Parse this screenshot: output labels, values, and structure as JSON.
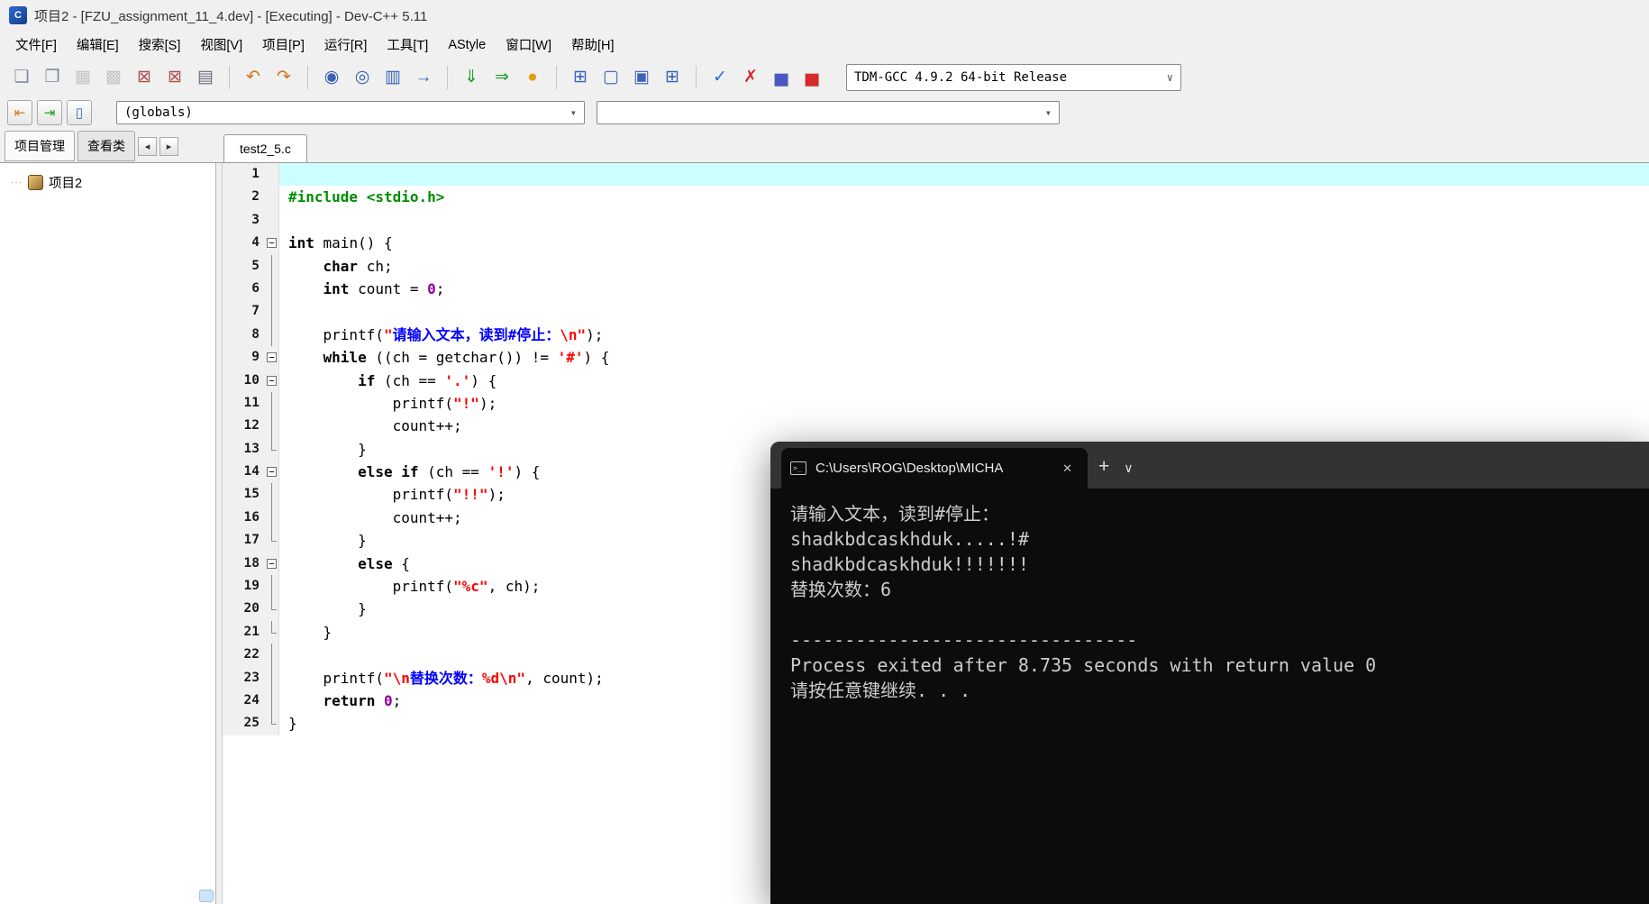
{
  "window": {
    "title": "项目2 - [FZU_assignment_11_4.dev] - [Executing] - Dev-C++ 5.11",
    "app_icon_text": "C"
  },
  "menu": {
    "items": [
      "文件[F]",
      "编辑[E]",
      "搜索[S]",
      "视图[V]",
      "项目[P]",
      "运行[R]",
      "工具[T]",
      "AStyle",
      "窗口[W]",
      "帮助[H]"
    ]
  },
  "toolbar_main": {
    "groups": [
      {
        "buttons": [
          {
            "name": "new-file-button",
            "icon": "new-file-icon",
            "glyph": "❏",
            "color": "#7a8aa0"
          },
          {
            "name": "open-file-button",
            "icon": "open-folder-icon",
            "glyph": "❐",
            "color": "#7a8aa0"
          },
          {
            "name": "save-button",
            "icon": "save-icon",
            "glyph": "▦",
            "color": "#8a8a8a",
            "disabled": true
          },
          {
            "name": "save-all-button",
            "icon": "save-all-icon",
            "glyph": "▩",
            "color": "#8a8a8a",
            "disabled": true
          },
          {
            "name": "close-file-button",
            "icon": "close-file-icon",
            "glyph": "⊠",
            "color": "#b05050"
          },
          {
            "name": "close-all-button",
            "icon": "close-all-icon",
            "glyph": "⊠",
            "color": "#b05050"
          },
          {
            "name": "print-button",
            "icon": "printer-icon",
            "glyph": "▤",
            "color": "#6a6a7a"
          }
        ]
      },
      {
        "buttons": [
          {
            "name": "undo-button",
            "icon": "undo-icon",
            "glyph": "↶",
            "color": "#d07820"
          },
          {
            "name": "redo-button",
            "icon": "redo-icon",
            "glyph": "↷",
            "color": "#d07820"
          }
        ]
      },
      {
        "buttons": [
          {
            "name": "find-button",
            "icon": "find-icon",
            "glyph": "◉",
            "color": "#3a62b8"
          },
          {
            "name": "find-in-files-button",
            "icon": "find-in-files-icon",
            "glyph": "◎",
            "color": "#3a62b8"
          },
          {
            "name": "replace-button",
            "icon": "replace-icon",
            "glyph": "▥",
            "color": "#3a62b8"
          },
          {
            "name": "goto-line-button",
            "icon": "goto-line-icon",
            "glyph": "→",
            "color": "#3a62b8"
          }
        ]
      },
      {
        "buttons": [
          {
            "name": "compile-button",
            "icon": "compile-icon",
            "glyph": "⇓",
            "color": "#1f9d28"
          },
          {
            "name": "run-button",
            "icon": "run-icon",
            "glyph": "⇒",
            "color": "#1f9d28"
          },
          {
            "name": "compile-run-button",
            "icon": "compile-run-icon",
            "glyph": "●",
            "color": "#e0a010"
          }
        ]
      },
      {
        "buttons": [
          {
            "name": "cascade-windows-button",
            "icon": "cascade-windows-icon",
            "glyph": "⊞",
            "color": "#3a62b8"
          },
          {
            "name": "tile-horizontal-button",
            "icon": "tile-horizontal-icon",
            "glyph": "▢",
            "color": "#3a62b8"
          },
          {
            "name": "tile-vertical-button",
            "icon": "tile-vertical-icon",
            "glyph": "▣",
            "color": "#3a62b8"
          },
          {
            "name": "arrange-windows-button",
            "icon": "arrange-windows-icon",
            "glyph": "⊞",
            "color": "#3a62b8"
          }
        ]
      },
      {
        "buttons": [
          {
            "name": "syntax-check-button",
            "icon": "check-icon",
            "glyph": "✓",
            "color": "#2b6cd4"
          },
          {
            "name": "abort-compile-button",
            "icon": "abort-x-icon",
            "glyph": "✗",
            "color": "#d42b2b"
          },
          {
            "name": "profile-button",
            "icon": "bar-chart-icon",
            "glyph": "▅",
            "color": "#4a58c0"
          },
          {
            "name": "delete-profiling-button",
            "icon": "bar-chart-delete-icon",
            "glyph": "▅",
            "color": "#d42b2b"
          }
        ]
      }
    ],
    "compiler_select": {
      "value": "TDM-GCC 4.9.2 64-bit Release",
      "arrow": "∨"
    }
  },
  "toolbar_browser": {
    "buttons": [
      {
        "name": "goto-declaration-button",
        "icon": "goto-declaration-icon",
        "glyph": "⇤",
        "color": "#d07820"
      },
      {
        "name": "goto-implementation-button",
        "icon": "goto-implementation-icon",
        "glyph": "⇥",
        "color": "#1f9d28"
      },
      {
        "name": "class-browser-button",
        "icon": "class-browser-icon",
        "glyph": "▯",
        "color": "#3a62b8"
      }
    ],
    "globals_combo": {
      "value": "(globals)",
      "arrow": "▾"
    },
    "members_combo": {
      "value": "",
      "arrow": "▾"
    }
  },
  "left_panel": {
    "tabs": [
      {
        "label": "项目管理",
        "active": true
      },
      {
        "label": "查看类",
        "active": false
      }
    ],
    "scroll_left_glyph": "◂",
    "scroll_right_glyph": "▸",
    "tree_root": "项目2",
    "tree_branch_dots": "···"
  },
  "editor": {
    "tab": "test2_5.c",
    "lines": [
      {
        "n": 1,
        "fold": "",
        "hl": true,
        "segs": []
      },
      {
        "n": 2,
        "fold": "",
        "segs": [
          [
            "d",
            "#include <stdio.h>"
          ]
        ]
      },
      {
        "n": 3,
        "fold": "",
        "segs": []
      },
      {
        "n": 4,
        "fold": "start",
        "segs": [
          [
            "k",
            "int"
          ],
          [
            "p",
            " main() {"
          ]
        ]
      },
      {
        "n": 5,
        "fold": "line",
        "segs": [
          [
            "p",
            "    "
          ],
          [
            "k",
            "char"
          ],
          [
            "p",
            " ch;"
          ]
        ]
      },
      {
        "n": 6,
        "fold": "line",
        "segs": [
          [
            "p",
            "    "
          ],
          [
            "k",
            "int"
          ],
          [
            "p",
            " count = "
          ],
          [
            "m",
            "0"
          ],
          [
            "p",
            ";"
          ]
        ]
      },
      {
        "n": 7,
        "fold": "line",
        "segs": []
      },
      {
        "n": 8,
        "fold": "line",
        "segs": [
          [
            "p",
            "    printf("
          ],
          [
            "s",
            "\""
          ],
          [
            "c",
            "请输入文本，读到#停止："
          ],
          [
            "s",
            "\\n\""
          ],
          [
            "p",
            ");"
          ]
        ]
      },
      {
        "n": 9,
        "fold": "start",
        "segs": [
          [
            "p",
            "    "
          ],
          [
            "k",
            "while"
          ],
          [
            "p",
            " ((ch = getchar()) != "
          ],
          [
            "s",
            "'#'"
          ],
          [
            "p",
            ") {"
          ]
        ]
      },
      {
        "n": 10,
        "fold": "start",
        "segs": [
          [
            "p",
            "        "
          ],
          [
            "k",
            "if"
          ],
          [
            "p",
            " (ch == "
          ],
          [
            "s",
            "'.'"
          ],
          [
            "p",
            ") {"
          ]
        ]
      },
      {
        "n": 11,
        "fold": "line",
        "segs": [
          [
            "p",
            "            printf("
          ],
          [
            "s",
            "\"!\""
          ],
          [
            "p",
            ");"
          ]
        ]
      },
      {
        "n": 12,
        "fold": "line",
        "segs": [
          [
            "p",
            "            count++;"
          ]
        ]
      },
      {
        "n": 13,
        "fold": "end",
        "segs": [
          [
            "p",
            "        }"
          ]
        ]
      },
      {
        "n": 14,
        "fold": "start",
        "segs": [
          [
            "p",
            "        "
          ],
          [
            "k",
            "else"
          ],
          [
            "p",
            " "
          ],
          [
            "k",
            "if"
          ],
          [
            "p",
            " (ch == "
          ],
          [
            "s",
            "'!'"
          ],
          [
            "p",
            ") {"
          ]
        ]
      },
      {
        "n": 15,
        "fold": "line",
        "segs": [
          [
            "p",
            "            printf("
          ],
          [
            "s",
            "\"!!\""
          ],
          [
            "p",
            ");"
          ]
        ]
      },
      {
        "n": 16,
        "fold": "line",
        "segs": [
          [
            "p",
            "            count++;"
          ]
        ]
      },
      {
        "n": 17,
        "fold": "end",
        "segs": [
          [
            "p",
            "        }"
          ]
        ]
      },
      {
        "n": 18,
        "fold": "start",
        "segs": [
          [
            "p",
            "        "
          ],
          [
            "k",
            "else"
          ],
          [
            "p",
            " {"
          ]
        ]
      },
      {
        "n": 19,
        "fold": "line",
        "segs": [
          [
            "p",
            "            printf("
          ],
          [
            "s",
            "\"%c\""
          ],
          [
            "p",
            ", ch);"
          ]
        ]
      },
      {
        "n": 20,
        "fold": "end",
        "segs": [
          [
            "p",
            "        }"
          ]
        ]
      },
      {
        "n": 21,
        "fold": "end",
        "segs": [
          [
            "p",
            "    }"
          ]
        ]
      },
      {
        "n": 22,
        "fold": "line",
        "segs": []
      },
      {
        "n": 23,
        "fold": "line",
        "segs": [
          [
            "p",
            "    printf("
          ],
          [
            "s",
            "\"\\n"
          ],
          [
            "c",
            "替换次数："
          ],
          [
            "s",
            "%d\\n\""
          ],
          [
            "p",
            ", count);"
          ]
        ]
      },
      {
        "n": 24,
        "fold": "line",
        "segs": [
          [
            "p",
            "    "
          ],
          [
            "k",
            "return"
          ],
          [
            "p",
            " "
          ],
          [
            "m",
            "0"
          ],
          [
            "p",
            ";"
          ]
        ]
      },
      {
        "n": 25,
        "fold": "end",
        "segs": [
          [
            "p",
            "}"
          ]
        ]
      }
    ]
  },
  "console": {
    "tab_title": "C:\\Users\\ROG\\Desktop\\MICHA",
    "icon_glyph": ">_",
    "close_glyph": "✕",
    "new_tab_glyph": "+",
    "menu_glyph": "∨",
    "lines": [
      "请输入文本，读到#停止：",
      "shadkbdcaskhduk.....!#",
      "shadkbdcaskhduk!!!!!!!",
      "替换次数：6",
      "",
      "--------------------------------",
      "Process exited after 8.735 seconds with return value 0",
      "请按任意键继续. . ."
    ]
  }
}
